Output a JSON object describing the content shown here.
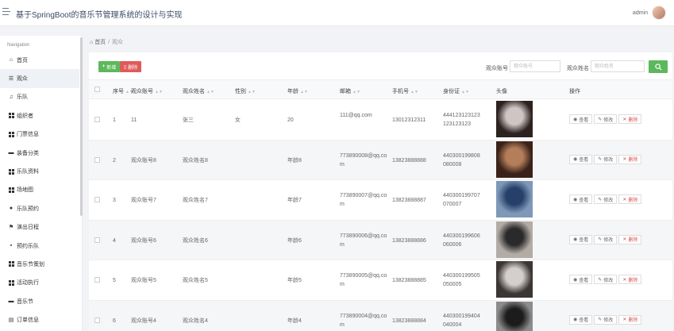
{
  "app": {
    "title": "基于SpringBoot的音乐节管理系统的设计与实现",
    "username": "admin"
  },
  "sidebar": {
    "heading": "Navigation",
    "items": [
      {
        "label": "首页",
        "icon": "home-icon"
      },
      {
        "label": "观众",
        "icon": "list-icon",
        "active": true
      },
      {
        "label": "乐队",
        "icon": "band-icon"
      },
      {
        "label": "组织者",
        "icon": "grid-icon"
      },
      {
        "label": "门票信息",
        "icon": "grid-icon"
      },
      {
        "label": "装备分类",
        "icon": "tv-icon"
      },
      {
        "label": "乐队资料",
        "icon": "grid-icon"
      },
      {
        "label": "场地图",
        "icon": "grid-icon"
      },
      {
        "label": "乐队预约",
        "icon": "pin-icon"
      },
      {
        "label": "演出日程",
        "icon": "flag-icon"
      },
      {
        "label": "预约乐队",
        "icon": "chat-icon"
      },
      {
        "label": "音乐节策划",
        "icon": "grid-icon"
      },
      {
        "label": "活动执行",
        "icon": "grid-icon"
      },
      {
        "label": "音乐节",
        "icon": "tv-icon"
      },
      {
        "label": "订单信息",
        "icon": "doc-icon"
      }
    ]
  },
  "breadcrumb": {
    "home": "首页",
    "sep": "/",
    "current": "观众"
  },
  "toolbar": {
    "add_label": "新增",
    "delete_label": "删除"
  },
  "search": {
    "field1_label": "观众账号",
    "field1_placeholder": "观众账号",
    "field2_label": "观众姓名",
    "field2_placeholder": "观众姓名"
  },
  "table": {
    "headers": [
      "序号",
      "观众账号",
      "观众姓名",
      "性别",
      "年龄",
      "邮箱",
      "手机号",
      "身份证",
      "头像",
      "操作"
    ],
    "action_labels": {
      "view": "查看",
      "edit": "修改",
      "delete": "删除"
    },
    "rows": [
      {
        "index": "1",
        "account": "11",
        "name": "张三",
        "gender": "女",
        "age": "20",
        "email": "111@qq.com",
        "phone": "13012312311",
        "id_card": "444123123123123123123",
        "avatar_colors": [
          "#cfc6c4",
          "#2c2220"
        ]
      },
      {
        "index": "2",
        "account": "观众账号8",
        "name": "观众姓名8",
        "gender": "",
        "age": "年龄8",
        "email": "773890008@qq.com",
        "phone": "13823888888",
        "id_card": "440300199808080008",
        "avatar_colors": [
          "#b47e5a",
          "#3a221a"
        ]
      },
      {
        "index": "3",
        "account": "观众账号7",
        "name": "观众姓名7",
        "gender": "",
        "age": "年龄7",
        "email": "773890007@qq.com",
        "phone": "13823888887",
        "id_card": "440300199707070007",
        "avatar_colors": [
          "#27406a",
          "#7f98b8"
        ]
      },
      {
        "index": "4",
        "account": "观众账号6",
        "name": "观众姓名6",
        "gender": "",
        "age": "年龄6",
        "email": "773890006@qq.com",
        "phone": "13823888886",
        "id_card": "440300199606060006",
        "avatar_colors": [
          "#2a2a2a",
          "#b3aca6"
        ]
      },
      {
        "index": "5",
        "account": "观众账号5",
        "name": "观众姓名5",
        "gender": "",
        "age": "年龄5",
        "email": "773890005@qq.com",
        "phone": "13823888885",
        "id_card": "440300199505050005",
        "avatar_colors": [
          "#d3cfcd",
          "#3b3533"
        ]
      },
      {
        "index": "6",
        "account": "观众账号4",
        "name": "观众姓名4",
        "gender": "",
        "age": "年龄4",
        "email": "773890004@qq.com",
        "phone": "13823888884",
        "id_card": "440300199404040004",
        "avatar_colors": [
          "#1c1c1c",
          "#8c8c8c"
        ]
      }
    ]
  },
  "colors": {
    "primary_green": "#5cb85c",
    "danger_red": "#e05a5a",
    "sidebar_active": "#eef1f6"
  }
}
